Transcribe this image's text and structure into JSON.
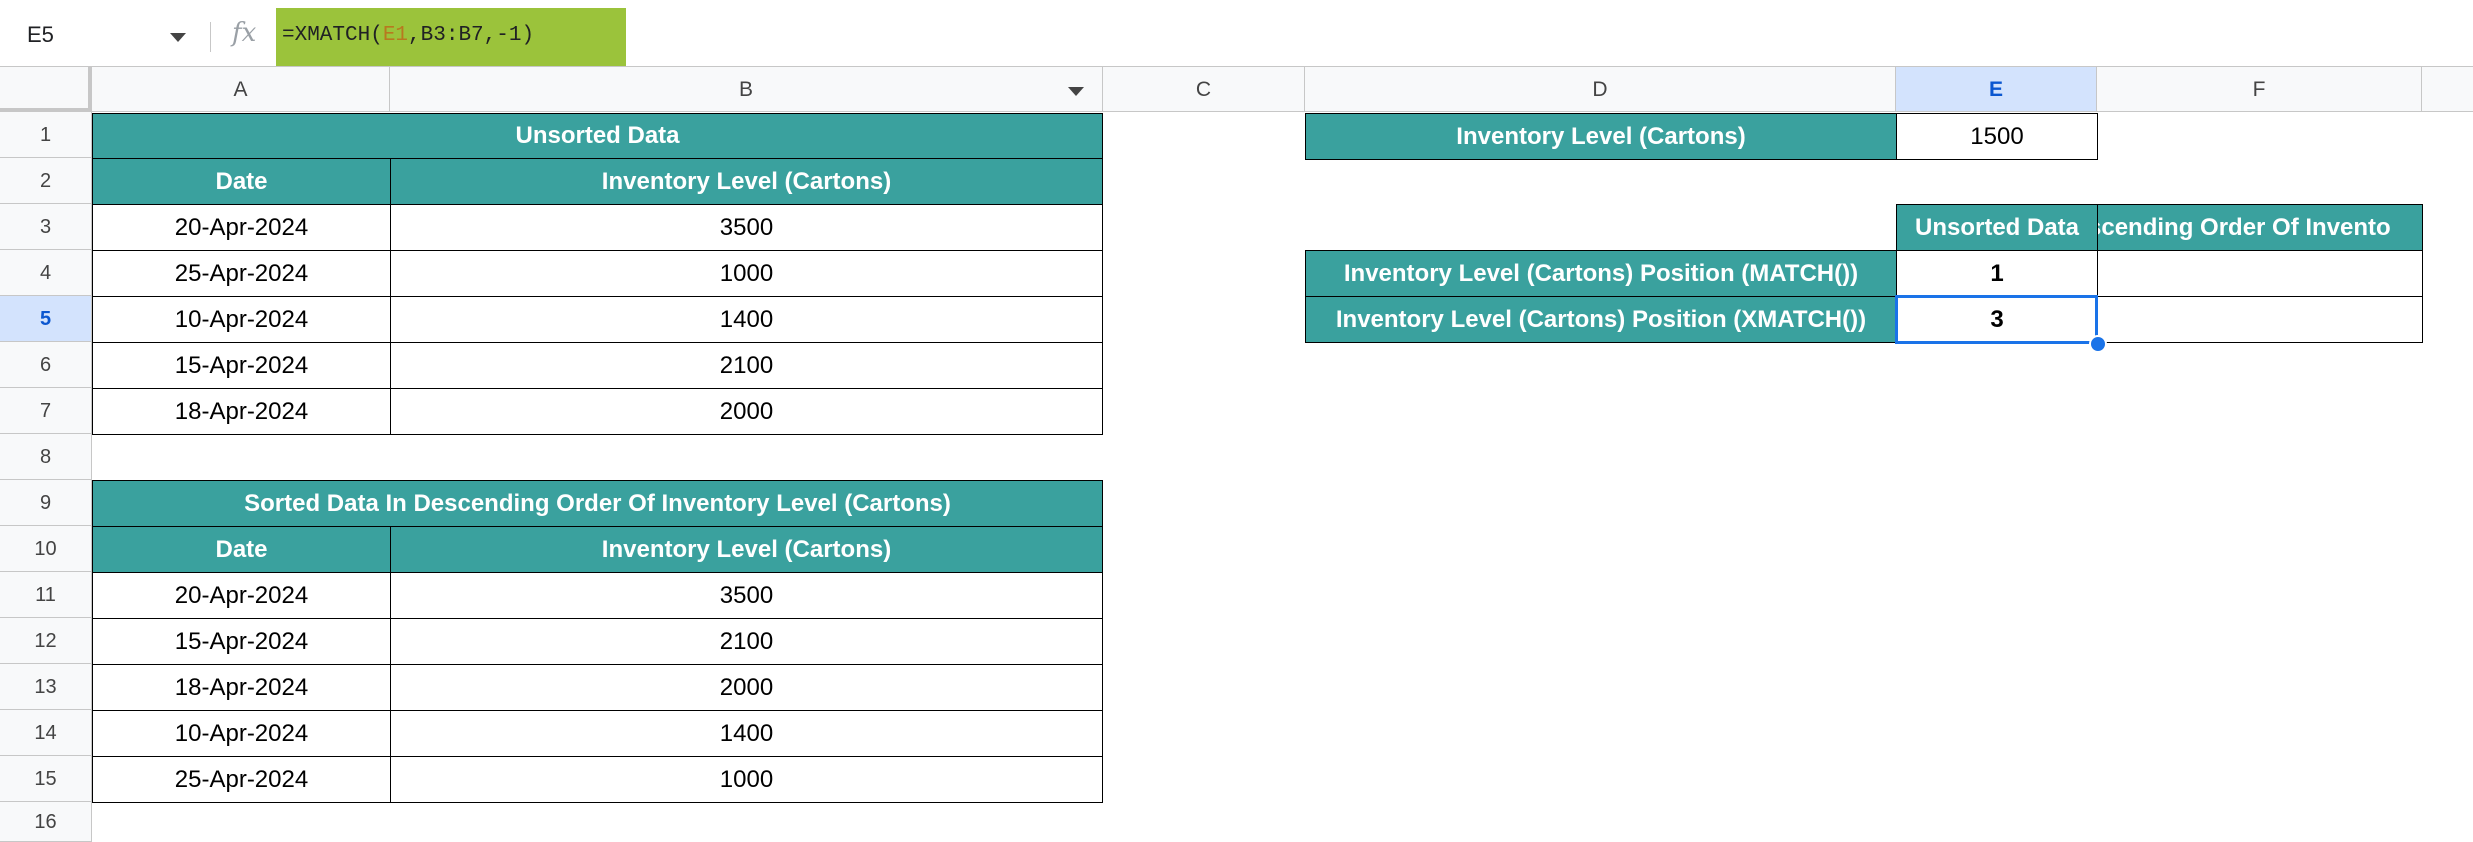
{
  "formula_bar": {
    "name_box": "E5",
    "fx_label": "fx",
    "formula_prefix": "=XMATCH(",
    "formula_ref": "E1",
    "formula_suffix": ",B3:B7,-1)"
  },
  "columns": [
    "A",
    "B",
    "C",
    "D",
    "E",
    "F"
  ],
  "rows": [
    "1",
    "2",
    "3",
    "4",
    "5",
    "6",
    "7",
    "8",
    "9",
    "10",
    "11",
    "12",
    "13",
    "14",
    "15",
    "16"
  ],
  "active_cell": "E5",
  "colors": {
    "header_fill": "#3aa19e",
    "formula_highlight": "#9bc33b",
    "selection": "#1a73e8",
    "selected_header": "#d3e3fd"
  },
  "unsorted": {
    "title": "Unsorted Data",
    "col_date": "Date",
    "col_level": "Inventory Level (Cartons)",
    "rows": [
      {
        "date": "20-Apr-2024",
        "level": "3500"
      },
      {
        "date": "25-Apr-2024",
        "level": "1000"
      },
      {
        "date": "10-Apr-2024",
        "level": "1400"
      },
      {
        "date": "15-Apr-2024",
        "level": "2100"
      },
      {
        "date": "18-Apr-2024",
        "level": "2000"
      }
    ]
  },
  "sorted": {
    "title": "Sorted Data In Descending Order Of Inventory Level (Cartons)",
    "col_date": "Date",
    "col_level": "Inventory Level (Cartons)",
    "rows": [
      {
        "date": "20-Apr-2024",
        "level": "3500"
      },
      {
        "date": "15-Apr-2024",
        "level": "2100"
      },
      {
        "date": "18-Apr-2024",
        "level": "2000"
      },
      {
        "date": "10-Apr-2024",
        "level": "1400"
      },
      {
        "date": "25-Apr-2024",
        "level": "1000"
      }
    ]
  },
  "lookup": {
    "label": "Inventory Level (Cartons)",
    "value": "1500"
  },
  "results": {
    "col_unsorted": "Unsorted Data",
    "col_sorted_visible": "scending Order Of Invento",
    "rows": [
      {
        "label": "Inventory Level (Cartons) Position (MATCH())",
        "unsorted": "1",
        "sorted": ""
      },
      {
        "label": "Inventory Level (Cartons) Position (XMATCH())",
        "unsorted": "3",
        "sorted": ""
      }
    ]
  }
}
